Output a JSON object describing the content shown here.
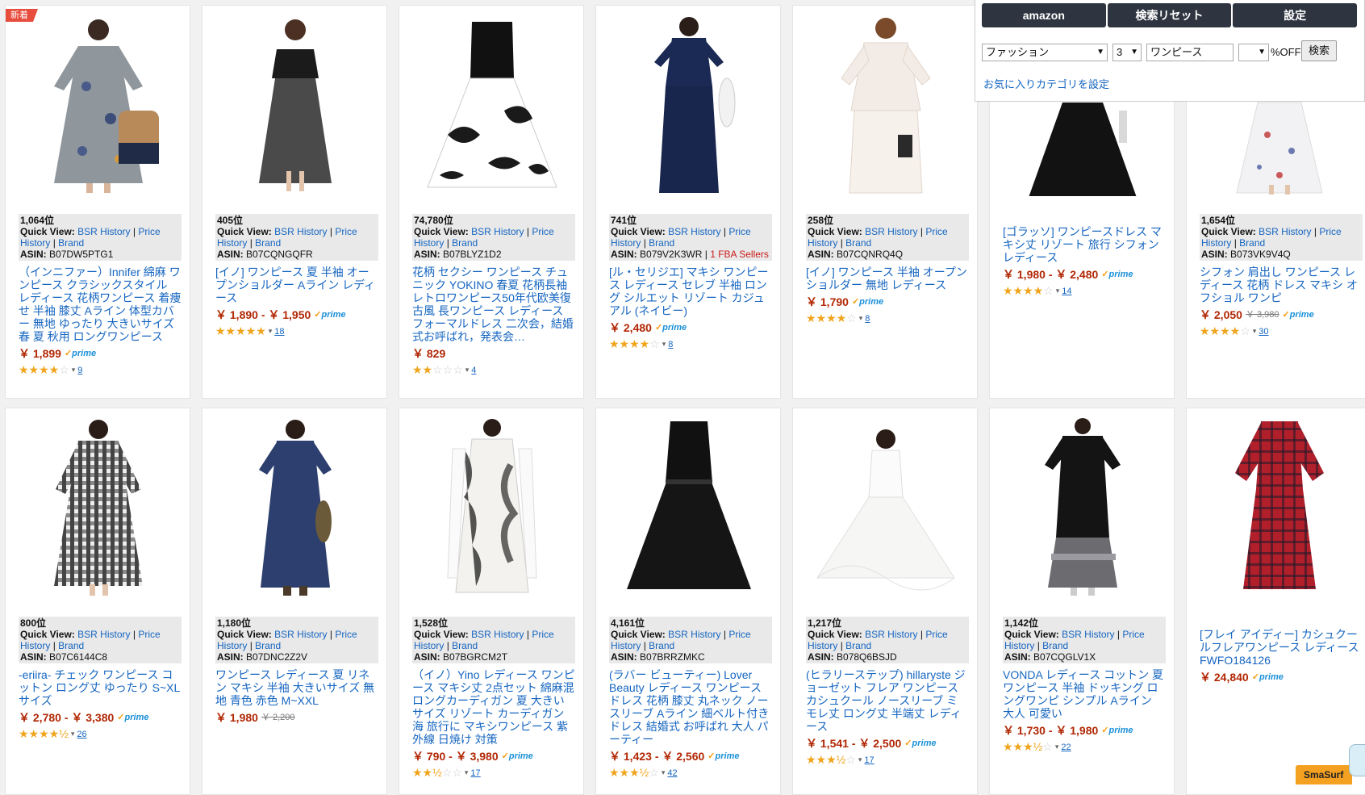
{
  "badge_new": "新着",
  "toolbar": {
    "tabs": [
      "amazon",
      "検索リセット",
      "設定"
    ],
    "category": "ファッション",
    "number": "3",
    "keyword": "ワンピース",
    "percent_off_value": "",
    "percent_off_label": "%OFF",
    "search_button": "検索",
    "favorite_link": "お気に入りカテゴリを設定"
  },
  "quick": {
    "quick_view": "Quick View:",
    "bsr_history": "BSR History",
    "sep": "|",
    "price": "Price",
    "history": "History",
    "brand": "Brand",
    "asin_label": "ASIN:",
    "prime": "prime"
  },
  "floating": {
    "smasurf": "SmaSurf"
  },
  "products": [
    {
      "rank": "1,064位",
      "asin": "B07DW5PTG1",
      "title": "（インニファー）Innifer 綿麻 ワンピース クラシックスタイル レディース 花柄ワンピース 着痩せ 半袖 膝丈 Aライン 体型カバー 無地 ゆったり 大きいサイズ 春 夏 秋用 ロングワンピース",
      "price": "￥ 1,899",
      "strike": "",
      "prime": true,
      "rating": 4,
      "count": "9"
    },
    {
      "rank": "405位",
      "asin": "B07CQNGQFR",
      "title": "[イノ] ワンピース 夏 半袖 オープンショルダー Aライン レディース",
      "price": "￥ 1,890 - ￥ 1,950",
      "strike": "",
      "prime": true,
      "rating": 5,
      "count": "18"
    },
    {
      "rank": "74,780位",
      "asin": "B07BLYZ1D2",
      "title": "花柄 セクシー ワンピース チュニック YOKINO 春夏 花柄長袖 レトロワンピース50年代欧美復古風 長ワンピース レディース フォーマルドレス 二次会，結婚式お呼ばれ，発表会…",
      "price": "￥ 829",
      "strike": "",
      "prime": false,
      "rating": 2,
      "count": "4"
    },
    {
      "rank": "741位",
      "asin": "B079V2K3WR",
      "fba": "1 FBA Sellers",
      "title": "[ル・セリジエ] マキシ ワンピース レディース セレブ 半袖 ロング シルエット リゾート カジュアル (ネイビー)",
      "price": "￥ 2,480",
      "strike": "",
      "prime": true,
      "rating": 4,
      "count": "8"
    },
    {
      "rank": "258位",
      "asin": "B07CQNRQ4Q",
      "title": "[イノ] ワンピース 半袖 オープンショルダー 無地 レディース",
      "price": "￥ 1,790",
      "strike": "",
      "prime": true,
      "rating": 4,
      "count": "8"
    },
    {
      "rank": "",
      "asin": "",
      "title": "[ゴラッソ] ワンピースドレス マキシ丈 リゾート 旅行 シフォン レディース",
      "price": "￥ 1,980 - ￥ 2,480",
      "strike": "",
      "prime": true,
      "rating": 4,
      "count": "14"
    },
    {
      "rank": "1,654位",
      "asin": "B073VK9V4Q",
      "title": "シフォン 肩出し ワンピース レディース 花柄 ドレス マキシ オフショル ワンピ",
      "price": "￥ 2,050",
      "strike": "￥ 3,980",
      "prime": true,
      "rating": 4.5,
      "count": "30"
    },
    {
      "rank": "800位",
      "asin": "B07C6144C8",
      "title": "-eriira- チェック ワンピース コットン ロング丈 ゆったり S~XLサイズ",
      "price": "￥ 2,780 - ￥ 3,380",
      "strike": "",
      "prime": true,
      "rating": 4.5,
      "count": "26"
    },
    {
      "rank": "1,180位",
      "asin": "B07DNC2Z2V",
      "title": "ワンピース レディース 夏 リネン マキシ 半袖 大きいサイズ 無地 青色 赤色 M~XXL",
      "price": "￥ 1,980",
      "strike": "￥ 2,200",
      "prime": false,
      "rating": 0,
      "count": ""
    },
    {
      "rank": "1,528位",
      "asin": "B07BGRCM2T",
      "title": "（イノ）Yino レディース ワンピース マキシ丈 2点セット 綿麻混 ロングカーディガン 夏 大きいサイズ リゾート カーディガン 海 旅行に マキシワンピース 紫外線 日焼け 対策",
      "price": "￥ 790 - ￥ 3,980",
      "strike": "",
      "prime": true,
      "rating": 2.5,
      "count": "17"
    },
    {
      "rank": "4,161位",
      "asin": "B07BRRZMKC",
      "title": "(ラバー ビューティー) Lover Beauty レディース ワンピース ドレス 花柄 膝丈 丸ネック ノースリーブ Aライン 細ベルト付き ドレス 結婚式 お呼ばれ 大人 パーティー",
      "price": "￥ 1,423 - ￥ 2,560",
      "strike": "",
      "prime": true,
      "rating": 3.5,
      "count": "42"
    },
    {
      "rank": "1,217位",
      "asin": "B078Q6BSJD",
      "title": "(ヒラリーステップ) hillaryste ジョーゼット フレア ワンピース カシュクール ノースリーブ ミモレ丈 ロング丈 半端丈 レディース",
      "price": "￥ 1,541 - ￥ 2,500",
      "strike": "",
      "prime": true,
      "rating": 3.5,
      "count": "17"
    },
    {
      "rank": "1,142位",
      "asin": "B07CQGLV1X",
      "title": "VONDA レディース コットン 夏 ワンピース 半袖 ドッキング ロングワンピ シンプル Aライン 大人 可愛い",
      "price": "￥ 1,730 - ￥ 1,980",
      "strike": "",
      "prime": true,
      "rating": 3.5,
      "count": "22"
    },
    {
      "rank": "",
      "asin": "",
      "title": "[フレイ アイディー] カシュクールフレアワンピース レディース FWFO184126",
      "price": "￥ 24,840",
      "strike": "",
      "prime": true,
      "rating": 0,
      "count": ""
    }
  ]
}
